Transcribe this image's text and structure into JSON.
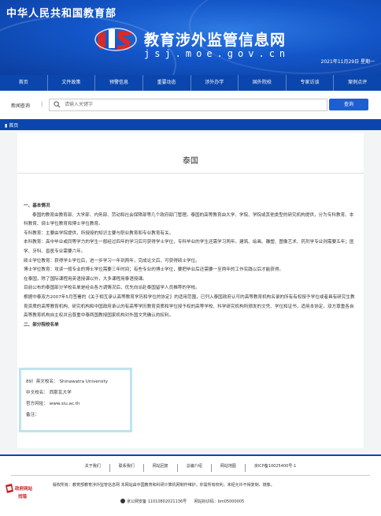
{
  "header": {
    "ministry": "中华人民共和国教育部",
    "site_title": "教育涉外监管信息网",
    "site_domain": "jsj.moe.gov.cn",
    "date": "2021年11月29日  星期一"
  },
  "nav": {
    "items": [
      {
        "label": "首页"
      },
      {
        "label": "文件政策"
      },
      {
        "label": "预警信息"
      },
      {
        "label": "重要动态"
      },
      {
        "label": "涉外办学"
      },
      {
        "label": "国外院校"
      },
      {
        "label": "专家访谈"
      },
      {
        "label": "案例点评"
      }
    ]
  },
  "search": {
    "label": "新闻查询",
    "separator": "|",
    "placeholder": "请输入关键字",
    "button": "查询"
  },
  "breadcrumb": {
    "home": "首页"
  },
  "article": {
    "title": "泰国",
    "section1_heading": "一、基本情况",
    "paragraphs": [
      "泰国的教育由教育部、大学部、内务部、劳动和社会保障部等几个政府部门管理。泰国的高等教育由大学、学院、学院或其他类型的研究机构提供，分为专科教育、本科教育、硕士学位教育和博士学位教育。",
      "专科教育：主要由学院提供，所授授的知识主要与职业教育和专业教育有关。",
      "本科教育：高中毕业或同等学力的学生一般经过四年的学习后可获得学士学位，专科毕业的学生还需学习两年。建筑、绘画、雕塑、图像艺术、药剂学专业则需要五年；医学、牙科、兽医专业需要六年。",
      "硕士学位教育：获得学士学位后，进一步学习一年到两年，完成论文后，可获得硕士学位。",
      "博士学位教育：攻读一般专业的博士学位需要三年时间；有些专业的博士学位，要把毕业后还需要一至两年的工作实践以后才能获得。",
      "在泰国，除了国际课程用英语授课以外，大多课程用泰语授课。",
      "目前公布的泰国部分学校名单是经合各方调情况后，优先向派赴泰国留学人员推荐的学校。",
      "根据中泰双方2007年5月签署的《关于相互承认高等教育学历和学位的协定》的适用范围，已列入泰国政府认可的高等教育机构名录的所有有权授予学位或者具有研究生教育资质的高等教育机构、研究机构和中国政府承认的有高等学历教育资质和学位授予权的高等学校、科学研究机构所颁发的文凭、学位和证书，适用本协定。双方尊重各自高等教育机构自主权并且尊重中泰两国教授国家机构对外国文凭确认的权利。"
    ],
    "section2_heading": "二、部分院校名单"
  },
  "school": {
    "english_name": "89）英文校名： Shinawatra University",
    "chinese_name": "中文校名：  西那瓦大学",
    "website": "官方网址：  www.siu.ac.th",
    "notes": "备注："
  },
  "footer": {
    "links": [
      {
        "label": "关于我们"
      },
      {
        "label": "联系我们"
      },
      {
        "label": "网站回复"
      },
      {
        "label": "总编介绍"
      },
      {
        "label": "网站地图"
      },
      {
        "label": "京ICP备10025400号-1"
      }
    ],
    "badge_line1": "政府网站",
    "badge_line2": "找错",
    "copyright": "版权所有：教育部教育涉外监管信息网 本网站由中国教育和科研计算机网制作维护。你需所有权利，未经允许不得复制、镜像。",
    "police_record": "京公网安备 11010802021136号",
    "site_code": "网站标识码：bm05000005",
    "colors": {
      "primary": "#0a46ad",
      "accent_box": "#bfe3ee",
      "button": "#1d5fd3"
    }
  }
}
